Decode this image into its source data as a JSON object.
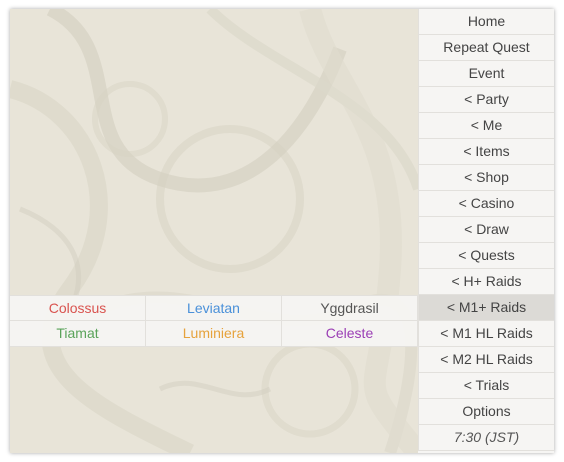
{
  "menu": {
    "items": [
      {
        "label": "Home"
      },
      {
        "label": "Repeat Quest"
      },
      {
        "label": "Event"
      },
      {
        "label": "< Party"
      },
      {
        "label": "< Me"
      },
      {
        "label": "< Items"
      },
      {
        "label": "< Shop"
      },
      {
        "label": "< Casino"
      },
      {
        "label": "< Draw"
      },
      {
        "label": "< Quests"
      },
      {
        "label": "< H+ Raids"
      },
      {
        "label": "< M1+ Raids",
        "active": true
      },
      {
        "label": "< M1 HL Raids"
      },
      {
        "label": "< M2 HL Raids"
      },
      {
        "label": "< Trials"
      },
      {
        "label": "Options"
      }
    ],
    "time": "7:30 (JST)"
  },
  "submenu": {
    "rows": [
      [
        {
          "label": "Colossus",
          "color": "#d9534f"
        },
        {
          "label": "Leviatan",
          "color": "#4a90d9"
        },
        {
          "label": "Yggdrasil",
          "color": "#555555"
        }
      ],
      [
        {
          "label": "Tiamat",
          "color": "#5aa35a"
        },
        {
          "label": "Luminiera",
          "color": "#e6a23c"
        },
        {
          "label": "Celeste",
          "color": "#9b3fb5"
        }
      ]
    ]
  },
  "colors": {
    "menu_bg": "#f6f5f3",
    "active_bg": "#dcdad6",
    "background": "#e7e3d7"
  }
}
